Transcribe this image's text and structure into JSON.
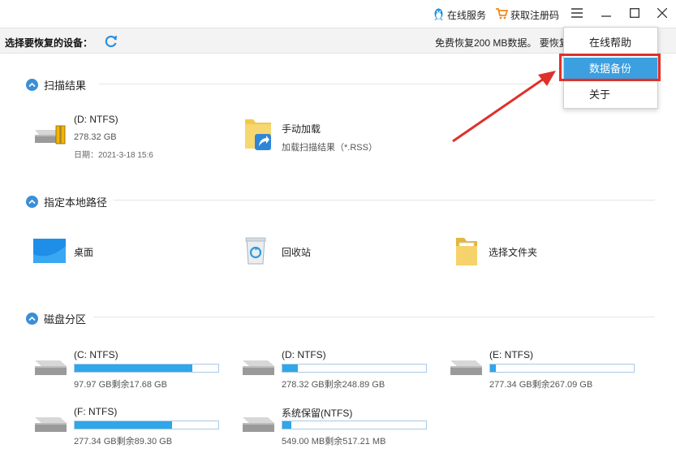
{
  "titlebar": {
    "online_service": "在线服务",
    "get_code": "获取注册码"
  },
  "device_bar": {
    "label": "选择要恢复的设备：",
    "free_text": "免费恢复200 MB数据。 要恢复"
  },
  "sections": {
    "scan": "扫描结果",
    "local": "指定本地路径",
    "disk": "磁盘分区"
  },
  "scan_results": {
    "drive_name": "(D: NTFS)",
    "drive_size": "278.32 GB",
    "drive_date": "日期：2021-3-18 15:6",
    "manual_name": "手动加载",
    "manual_sub": "加载扫描结果（*.RSS）"
  },
  "local_paths": {
    "desktop": "桌面",
    "recycle": "回收站",
    "folder": "选择文件夹"
  },
  "partitions": [
    {
      "name": "(C: NTFS)",
      "detail": "97.97 GB剩余17.68 GB",
      "used_fraction": 0.82
    },
    {
      "name": "(D: NTFS)",
      "detail": "278.32 GB剩余248.89 GB",
      "used_fraction": 0.11
    },
    {
      "name": "(E: NTFS)",
      "detail": "277.34 GB剩余267.09 GB",
      "used_fraction": 0.04
    },
    {
      "name": "(F: NTFS)",
      "detail": "277.34 GB剩余89.30 GB",
      "used_fraction": 0.68
    },
    {
      "name": "系统保留(NTFS)",
      "detail": "549.00 MB剩余517.21 MB",
      "used_fraction": 0.06
    }
  ],
  "menu": {
    "items": [
      "在线帮助",
      "数据备份",
      "关于"
    ],
    "active_index": 1
  },
  "colors": {
    "accent": "#3c9fe0",
    "bar_fill": "#2fa7e8",
    "annotation": "#e0302a"
  }
}
